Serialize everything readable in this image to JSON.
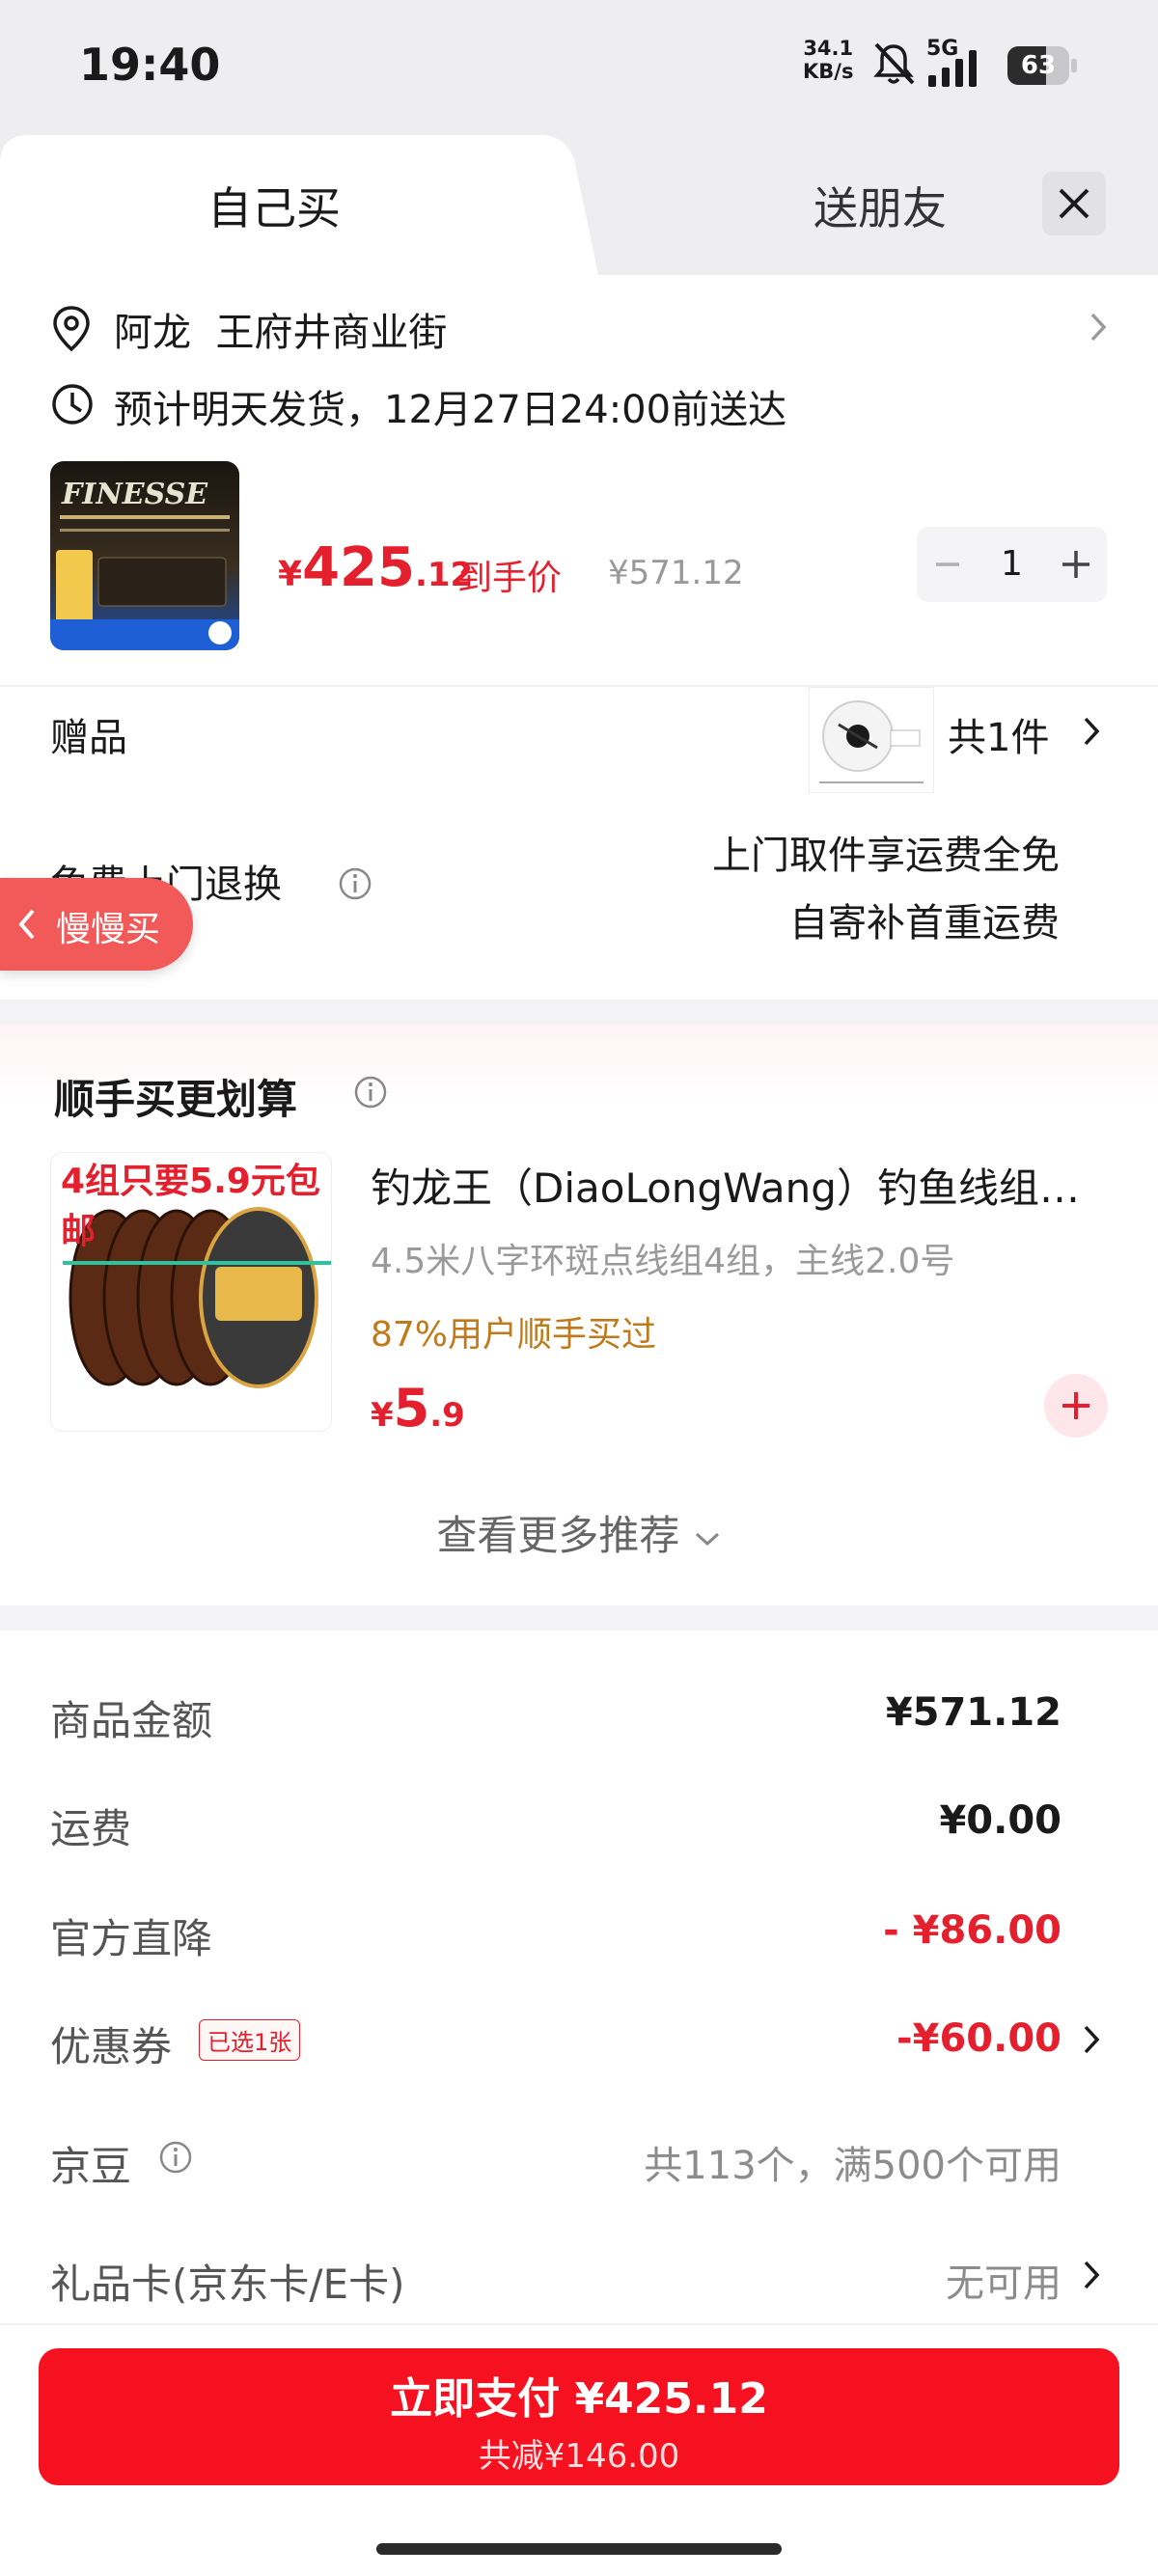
{
  "status_bar": {
    "time": "19:40",
    "net_speed_value": "34.1",
    "net_speed_unit": "KB/s",
    "network": "5G",
    "battery": "63"
  },
  "tabs": {
    "self_buy": "自己买",
    "gift_friend": "送朋友"
  },
  "address": {
    "name": "阿龙",
    "location": "王府井商业街"
  },
  "delivery": {
    "text": "预计明天发货，12月27日24:00前送达"
  },
  "product": {
    "brand_text": "FINESSE",
    "price_currency": "¥",
    "price_integer": "425",
    "price_decimal": ".12",
    "price_tag": "到手价",
    "original_price": "¥571.12",
    "quantity": "1"
  },
  "gift": {
    "label": "赠品",
    "count": "共1件"
  },
  "free_return": {
    "label": "免费上门退换",
    "line1": "上门取件享运费全免",
    "line2": "自寄补首重运费"
  },
  "floating": {
    "slow_buy": "慢慢买"
  },
  "recommend": {
    "title": "顺手买更划算",
    "banner": "4组只要5.9元包邮",
    "name": "钓龙王（DiaoLongWang）钓鱼线组线组成品鱼线",
    "spec": "4.5米八字环斑点线组4组，主线2.0号",
    "bought_pct": "87%用户顺手买过",
    "price_currency": "¥",
    "price_integer": "5",
    "price_decimal": ".9",
    "see_more": "查看更多推荐"
  },
  "summary": {
    "goods_label": "商品金额",
    "goods_value": "¥571.12",
    "shipping_label": "运费",
    "shipping_value": "¥0.00",
    "official_cut_label": "官方直降",
    "official_cut_value": "- ¥86.00",
    "coupon_label": "优惠券",
    "coupon_badge": "已选1张",
    "coupon_value": "-¥60.00",
    "jingdou_label": "京豆",
    "jingdou_value": "共113个，满500个可用",
    "giftcard_label": "礼品卡(京东卡/E卡)",
    "giftcard_value": "无可用"
  },
  "pay": {
    "label": "立即支付 ¥425.12",
    "saving": "共减¥146.00"
  },
  "colors": {
    "accent_red": "#e5202e",
    "pay_button": "#f5111f",
    "bought_orange": "#c07a1a"
  },
  "icons": [
    "location-pin-icon",
    "clock-icon",
    "info-icon",
    "close-icon",
    "chevron-right-icon",
    "chevron-down-icon",
    "plus-icon",
    "minus-icon",
    "chevron-left-icon",
    "mute-icon",
    "signal-icon",
    "battery-icon"
  ]
}
